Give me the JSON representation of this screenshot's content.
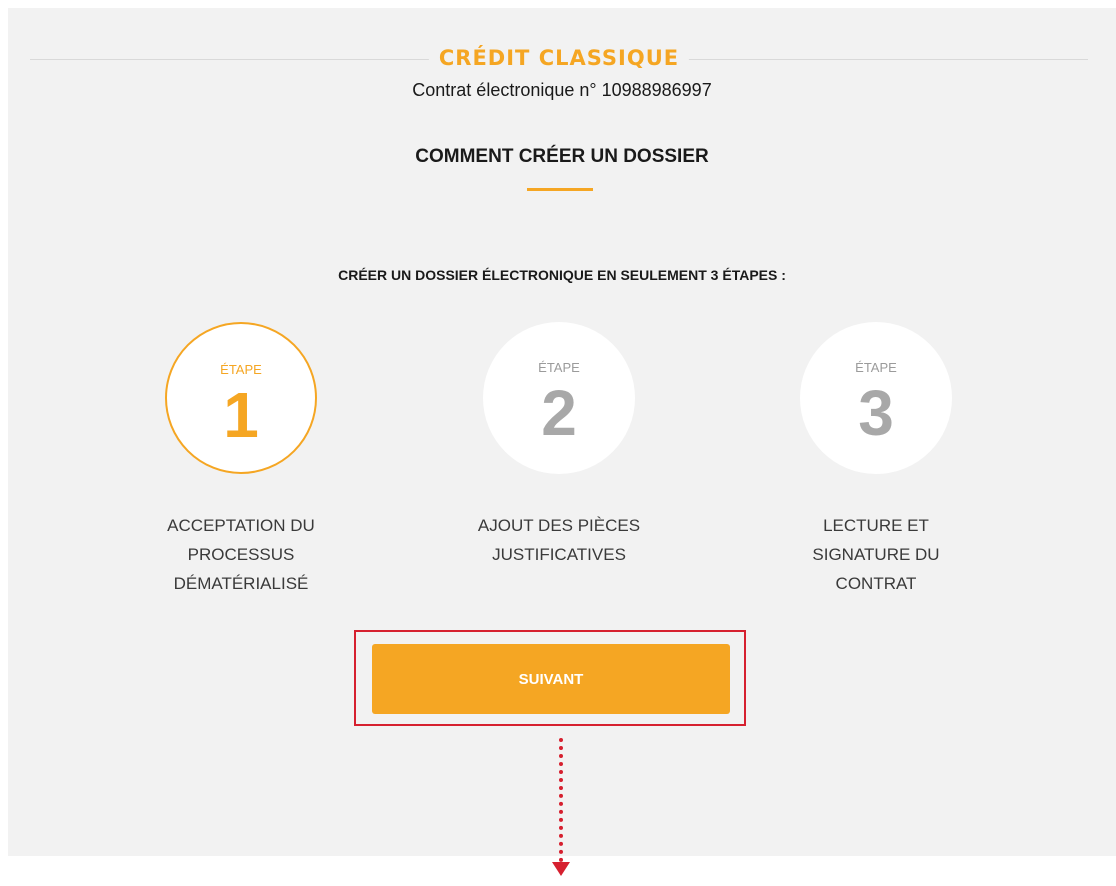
{
  "header": {
    "product_title": "CRÉDIT CLASSIQUE",
    "contract_text": "Contrat électronique n° 10988986997"
  },
  "intro": {
    "title": "COMMENT CRÉER UN DOSSIER",
    "steps_heading": "CRÉER UN DOSSIER ÉLECTRONIQUE EN SEULEMENT 3 ÉTAPES :"
  },
  "steps": [
    {
      "label": "ÉTAPE",
      "number": "1",
      "description": "ACCEPTATION DU\nPROCESSUS\nDÉMATÉRIALISÉ",
      "active": true
    },
    {
      "label": "ÉTAPE",
      "number": "2",
      "description": "AJOUT DES PIÈCES\nJUSTIFICATIVES",
      "active": false
    },
    {
      "label": "ÉTAPE",
      "number": "3",
      "description": "LECTURE ET\nSIGNATURE DU\nCONTRAT",
      "active": false
    }
  ],
  "actions": {
    "next_label": "SUIVANT"
  },
  "colors": {
    "accent": "#f5a623",
    "annotation": "#d6202f",
    "panel_background": "#f2f2f2",
    "inactive_step": "#a8a8a8"
  },
  "icons": {
    "annotation_arrow": "arrow-down-icon"
  }
}
